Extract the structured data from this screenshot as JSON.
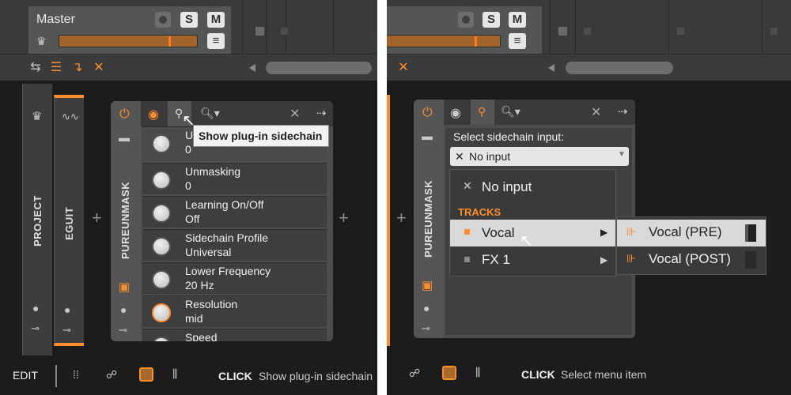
{
  "left": {
    "master": {
      "label": "Master",
      "solo": "S",
      "mute": "M"
    },
    "device": {
      "name": "PUREUNMASK",
      "search_placeholder": "",
      "params": [
        {
          "name": "U",
          "value": "0"
        },
        {
          "name": "Unmasking",
          "value": "0"
        },
        {
          "name": "Learning On/Off",
          "value": "Off"
        },
        {
          "name": "Sidechain Profile",
          "value": "Universal"
        },
        {
          "name": "Lower Frequency",
          "value": "20 Hz"
        },
        {
          "name": "Resolution",
          "value": "mid"
        },
        {
          "name": "Speed",
          "value": ""
        }
      ]
    },
    "side_panels": {
      "project": "PROJECT",
      "eguit": "EGUIT"
    },
    "tooltip": "Show plug-in sidechain",
    "status": {
      "mode": "EDIT",
      "action": "CLICK",
      "hint": "Show plug-in sidechain"
    }
  },
  "right": {
    "device": {
      "name": "PUREUNMASK"
    },
    "sidechain": {
      "title": "Select sidechain input:",
      "current": "No input",
      "menu": {
        "no_input": "No input",
        "section": "TRACKS",
        "items": [
          "Vocal",
          "FX 1"
        ]
      },
      "submenu": [
        "Vocal (PRE)",
        "Vocal (POST)"
      ]
    },
    "status": {
      "action": "CLICK",
      "hint": "Select menu item"
    }
  },
  "colors": {
    "accent": "#ff8d2a",
    "bg": "#1c1c1c",
    "panel": "#4d4d4d"
  }
}
